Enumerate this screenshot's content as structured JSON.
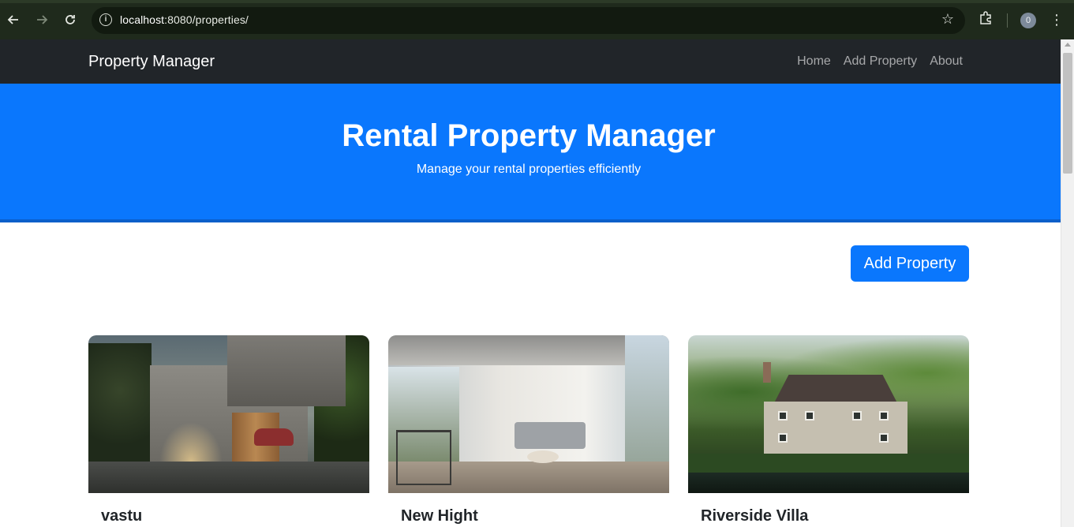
{
  "browser": {
    "url_host": "localhost",
    "url_path": ":8080/properties/",
    "profile_initial": "0",
    "icons": {
      "back": "arrow-left-icon",
      "forward": "arrow-right-icon",
      "reload": "reload-icon",
      "info": "info-icon",
      "bookmark": "star-icon",
      "extensions": "puzzle-icon",
      "menu": "more-vert-icon"
    }
  },
  "navbar": {
    "brand": "Property Manager",
    "links": [
      "Home",
      "Add Property",
      "About"
    ]
  },
  "hero": {
    "title": "Rental Property Manager",
    "subtitle": "Manage your rental properties efficiently"
  },
  "actions": {
    "add_property_label": "Add Property"
  },
  "properties": [
    {
      "name": "vastu",
      "image": "modern-house-photo"
    },
    {
      "name": "New Hight",
      "image": "apartment-interior-photo"
    },
    {
      "name": "Riverside Villa",
      "image": "riverside-villa-photo"
    }
  ],
  "colors": {
    "primary": "#0a77fd",
    "navbar_bg": "#212529",
    "browser_chrome": "#1f2a1c"
  }
}
